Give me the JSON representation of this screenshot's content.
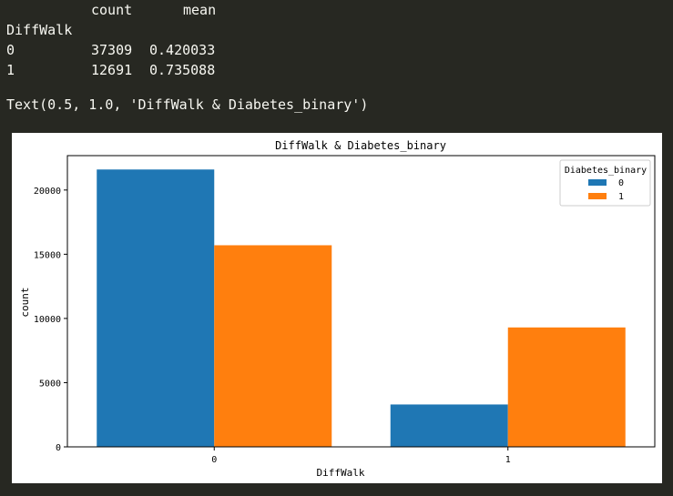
{
  "dataframe": {
    "columns": [
      "count",
      "mean"
    ],
    "index_name": "DiffWalk",
    "rows": [
      {
        "index": "0",
        "count": "37309",
        "mean": "0.420033"
      },
      {
        "index": "1",
        "count": "12691",
        "mean": "0.735088"
      }
    ]
  },
  "repr_text": "Text(0.5, 1.0, 'DiffWalk & Diabetes_binary')",
  "chart_data": {
    "type": "bar",
    "title": "DiffWalk & Diabetes_binary",
    "xlabel": "DiffWalk",
    "ylabel": "count",
    "categories": [
      "0",
      "1"
    ],
    "series": [
      {
        "name": "0",
        "color": "#1f77b4",
        "values": [
          21600,
          3300
        ]
      },
      {
        "name": "1",
        "color": "#ff7f0e",
        "values": [
          15700,
          9300
        ]
      }
    ],
    "yticks": [
      0,
      5000,
      10000,
      15000,
      20000
    ],
    "ylim": [
      0,
      22680
    ],
    "legend": {
      "title": "Diabetes_binary",
      "position": "top-right"
    },
    "grid": false
  }
}
